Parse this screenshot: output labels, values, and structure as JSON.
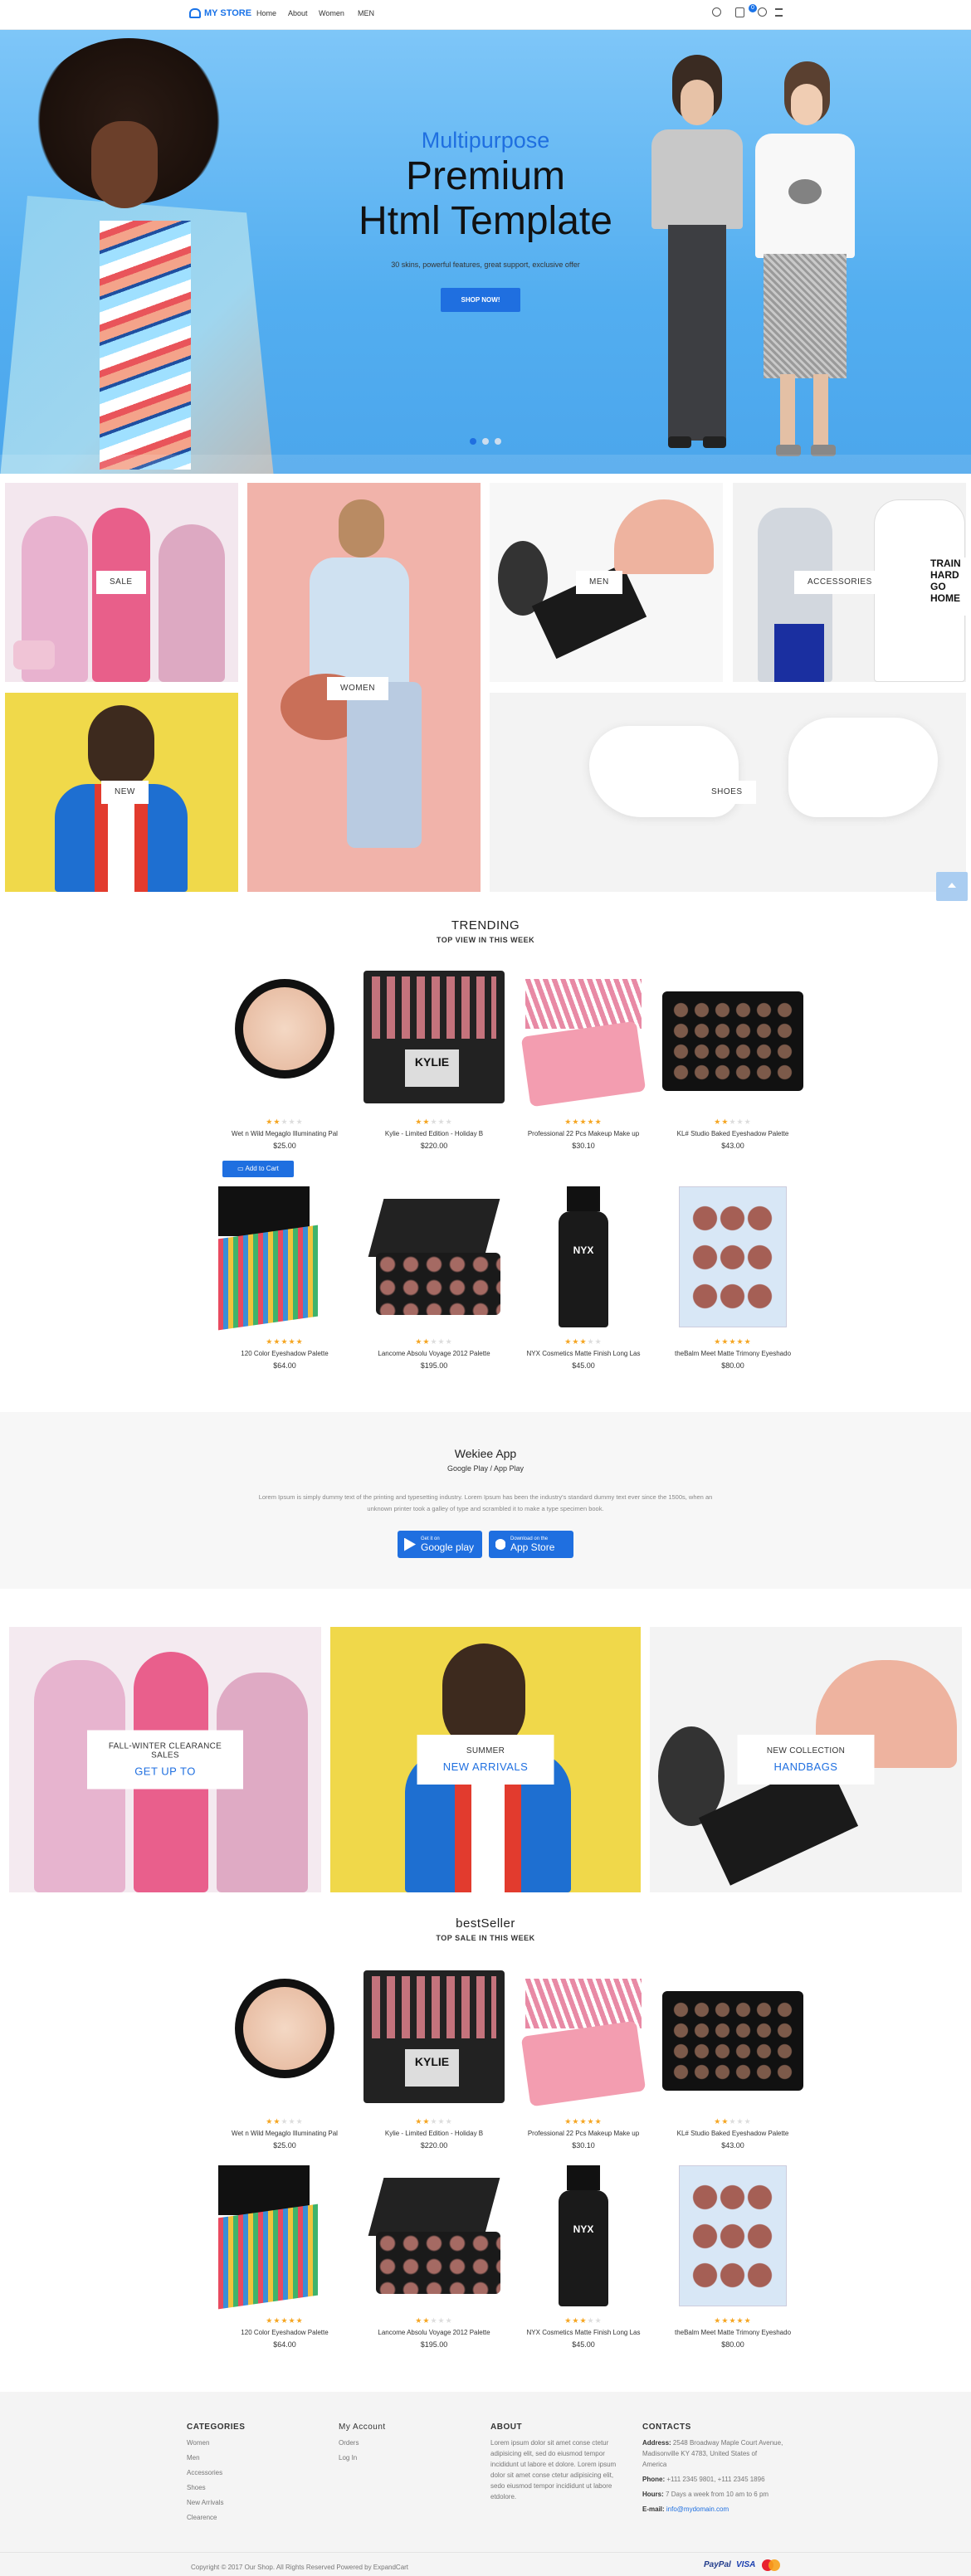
{
  "header": {
    "logo": "MY STORE",
    "nav": [
      "Home",
      "About",
      "Women",
      "MEN"
    ],
    "cart_count": "0"
  },
  "hero": {
    "title_line1": "Multipurpose",
    "title_line2": "Premium",
    "title_line3": "Html Template",
    "subtitle": "30 skins, powerful features, great support, exclusive offer",
    "button": "SHOP NOW!",
    "slides": 3,
    "active_slide": 1
  },
  "categories": [
    "SALE",
    "WOMEN",
    "MEN",
    "ACCESSORIES",
    "NEW",
    "SHOES"
  ],
  "trending": {
    "title": "TRENDING",
    "subtitle": "TOP VIEW IN THIS WEEK",
    "add_to_cart": "Add to Cart",
    "products": [
      {
        "name": "Wet n Wild Megaglo Illuminating Pal",
        "price": "$25.00",
        "rating": 2
      },
      {
        "name": "Kylie - Limited Edition - Holiday B",
        "price": "$220.00",
        "rating": 2
      },
      {
        "name": "Professional 22 Pcs Makeup Make up",
        "price": "$30.10",
        "rating": 5
      },
      {
        "name": "KL# Studio Baked Eyeshadow Palette",
        "price": "$43.00",
        "rating": 2
      },
      {
        "name": "120 Color Eyeshadow Palette",
        "price": "$64.00",
        "rating": 5
      },
      {
        "name": "Lancome Absolu Voyage 2012 Palette",
        "price": "$195.00",
        "rating": 2
      },
      {
        "name": "NYX Cosmetics Matte Finish Long Las",
        "price": "$45.00",
        "rating": 3
      },
      {
        "name": "theBalm Meet Matte Trimony Eyeshado",
        "price": "$80.00",
        "rating": 5
      }
    ]
  },
  "app": {
    "title": "Wekiee App",
    "subtitle": "Google Play / App Play",
    "text_line1": "Lorem Ipsum is simply dummy text of the printing and typesetting industry. Lorem Ipsum has been the industry's standard dummy text ever since the 1500s, when an",
    "text_line2": "unknown printer took a galley of type and scrambled it to make a type specimen book.",
    "google_small": "Get it on",
    "google_big": "Google play",
    "apple_small": "Download on the",
    "apple_big": "App Store"
  },
  "promos": [
    {
      "line1": "FALL-WINTER CLEARANCE SALES",
      "line2": "GET UP TO"
    },
    {
      "line1": "SUMMER",
      "line2": "NEW ARRIVALS"
    },
    {
      "line1": "NEW COLLECTION",
      "line2": "HANDBAGS"
    }
  ],
  "bestseller": {
    "title": "bestSeller",
    "subtitle": "TOP SALE IN THIS WEEK"
  },
  "footer": {
    "col1_title": "CATEGORIES",
    "col1_links": [
      "Women",
      "Men",
      "Accessories",
      "Shoes",
      "New Arrivals",
      "Clearence"
    ],
    "col2_title": "My Account",
    "col2_links": [
      "Orders",
      "Log In"
    ],
    "col3_title": "ABOUT",
    "col3_text": [
      "Lorem ipsum dolor sit amet conse ctetur",
      "adipisicing elit, sed do eiusmod tempor",
      "incididunt ut labore et dolore. Lorem ipsum",
      "dolor sit amet conse ctetur adipisicing elit,",
      "sedo eiusmod tempor incididunt ut labore",
      "etdolore."
    ],
    "col4_title": "CONTACTS",
    "address_label": "Address:",
    "address": [
      "2548 Broadway Maple Court Avenue,",
      "Madisonville KY 4783, United States of",
      "America"
    ],
    "phone_label": "Phone:",
    "phone": "+111 2345 9801, +111 2345 1896",
    "hours_label": "Hours:",
    "hours": "7 Days a week from 10 am to 6 pm",
    "email_label": "E-mail:",
    "email": "info@mydomain.com",
    "copyright": "Copyright © 2017 Our Shop. All Rights Reserved Powered by ExpandCart",
    "payments": [
      "PayPal",
      "VISA",
      "MC"
    ]
  },
  "colors": {
    "accent": "#1f6fe0",
    "hero_bg": "#55aff0",
    "star": "#f5a623"
  }
}
